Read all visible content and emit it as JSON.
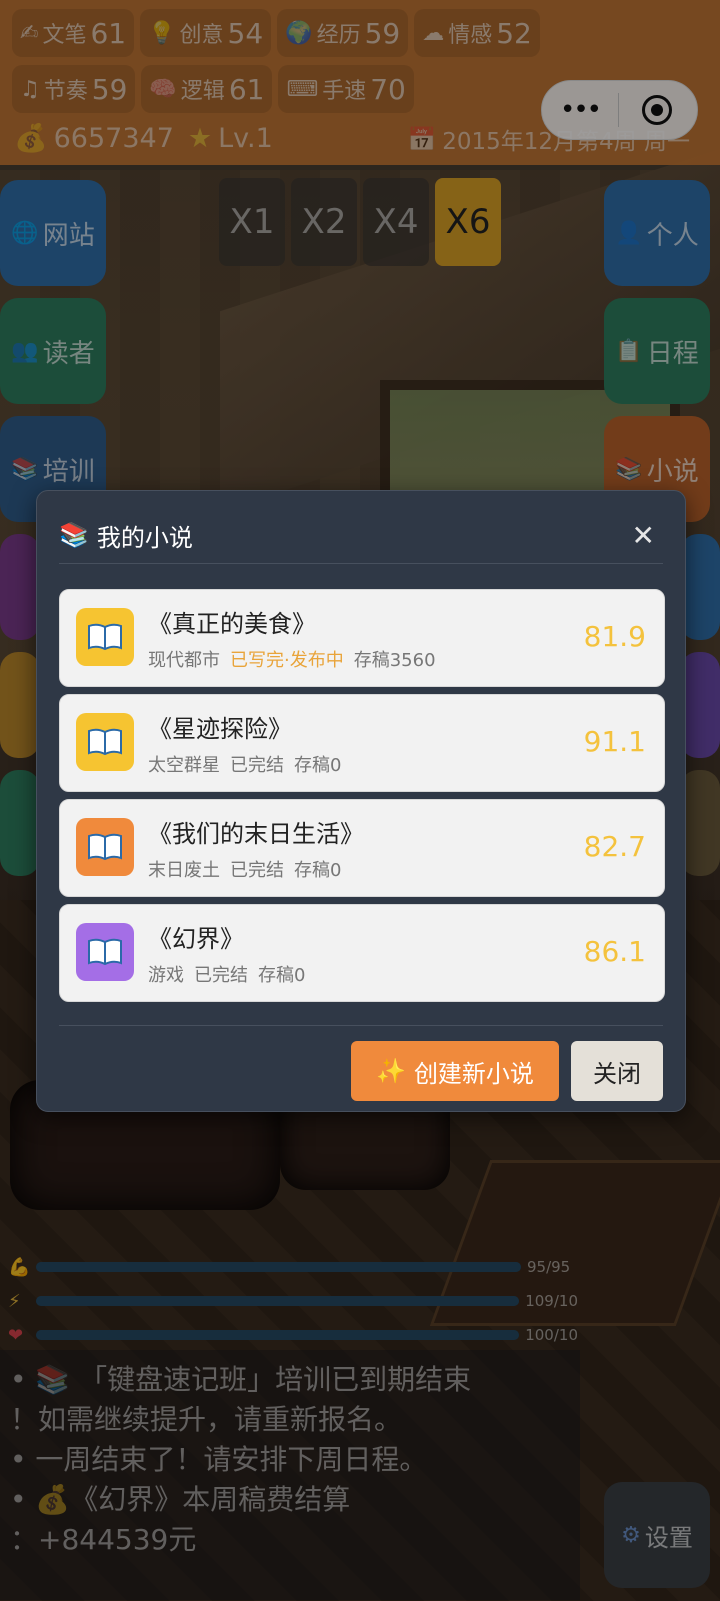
{
  "stats": {
    "row1": [
      {
        "icon": "✍",
        "label": "文笔",
        "value": "61"
      },
      {
        "icon": "💡",
        "label": "创意",
        "value": "54"
      },
      {
        "icon": "🌍",
        "label": "经历",
        "value": "59"
      },
      {
        "icon": "☁",
        "label": "情感",
        "value": "52"
      }
    ],
    "row2": [
      {
        "icon": "♫",
        "label": "节奏",
        "value": "59"
      },
      {
        "icon": "🧠",
        "label": "逻辑",
        "value": "61"
      },
      {
        "icon": "⌨",
        "label": "手速",
        "value": "70"
      }
    ],
    "money": "6657347",
    "level": "Lv.1",
    "date": "2015年12月第4周 周一"
  },
  "speeds": [
    "X1",
    "X2",
    "X4",
    "X6"
  ],
  "active_speed": "X6",
  "left_menu": [
    {
      "icon": "🌐",
      "label": "网站",
      "color": "#2f6ea8"
    },
    {
      "icon": "👥",
      "label": "读者",
      "color": "#2e7d5e"
    },
    {
      "icon": "📚",
      "label": "培训",
      "color": "#2f5d8a"
    }
  ],
  "right_menu": [
    {
      "icon": "👤",
      "label": "个人",
      "color": "#2f6ea8"
    },
    {
      "icon": "📋",
      "label": "日程",
      "color": "#2e7d5e"
    },
    {
      "icon": "📚",
      "label": "小说",
      "color": "#b8622a"
    }
  ],
  "bars": [
    {
      "icon": "💪",
      "value": 1.0,
      "text": "95/95"
    },
    {
      "icon": "⚡",
      "value": 1.0,
      "text": "109/10"
    },
    {
      "icon": "❤",
      "value": 1.0,
      "text": "100/10"
    }
  ],
  "log": [
    "• 📚 「键盘速记班」培训已到期结束",
    "！如需继续提升，请重新报名。",
    "• 一周结束了！请安排下周日程。",
    "• 💰《幻界》本周稿费结算",
    "：+844539元"
  ],
  "settings_label": "设置",
  "modal": {
    "title": "我的小说",
    "novels": [
      {
        "title": "《真正的美食》",
        "genre": "现代都市",
        "status": "已写完·发布中",
        "status_highlight": true,
        "draft": "存稿3560",
        "score": "81.9",
        "cover_color": "#f6c431"
      },
      {
        "title": "《星迹探险》",
        "genre": "太空群星",
        "status": "已完结",
        "status_highlight": false,
        "draft": "存稿0",
        "score": "91.1",
        "cover_color": "#f6c431"
      },
      {
        "title": "《我们的末日生活》",
        "genre": "末日废土",
        "status": "已完结",
        "status_highlight": false,
        "draft": "存稿0",
        "score": "82.7",
        "cover_color": "#f08a3c"
      },
      {
        "title": "《幻界》",
        "genre": "游戏",
        "status": "已完结",
        "status_highlight": false,
        "draft": "存稿0",
        "score": "86.1",
        "cover_color": "#a46ee6"
      }
    ],
    "create_button": "创建新小说",
    "close_button": "关闭"
  }
}
